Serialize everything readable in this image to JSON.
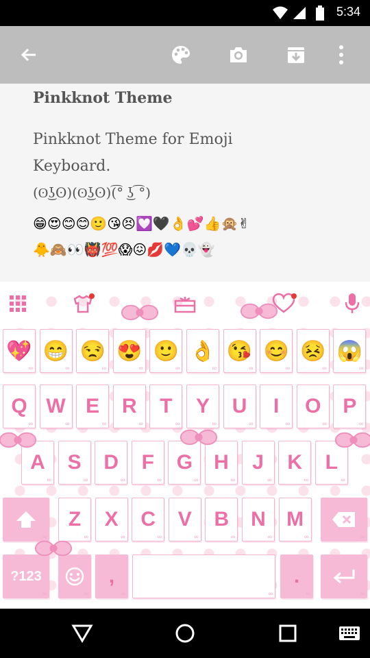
{
  "status_bar": {
    "time": "5:34",
    "icons": [
      "wifi-icon",
      "signal-icon",
      "battery-icon"
    ]
  },
  "app_bar": {
    "icons": [
      "back-arrow-icon",
      "palette-icon",
      "camera-icon",
      "archive-icon",
      "more-vert-icon"
    ]
  },
  "note": {
    "title": "Pinkknot Theme",
    "line1": "Pinkknot Theme for Emoji",
    "line2": "Keyboard.",
    "line3": "(ʘ͜ʖʘ)(ʘ͜ʖʘ)(͡° ͜ʖ ͡°)",
    "emoji_row1": "😁😍😊😊🙂😘😣💟🖤👌💕👍🙊✌",
    "emoji_row2": "🐥🙈👀👹💯😱😖💋💙💀👻"
  },
  "keyboard": {
    "toolbar_icons": [
      "apps-grid-icon",
      "theme-shirt-icon",
      "gift-icon",
      "heart-icon",
      "microphone-icon"
    ],
    "emoji_suggestions": [
      "💖",
      "😁",
      "😒",
      "😍",
      "🙂",
      "👌",
      "😘",
      "😊",
      "😣",
      "😱"
    ],
    "row1": [
      "Q",
      "W",
      "E",
      "R",
      "T",
      "Y",
      "U",
      "I",
      "O",
      "P"
    ],
    "row2": [
      "A",
      "S",
      "D",
      "F",
      "G",
      "H",
      "J",
      "K",
      "L"
    ],
    "row3": [
      "Z",
      "X",
      "C",
      "V",
      "B",
      "N",
      "M"
    ],
    "shift_icon": "shift-icon",
    "backspace_icon": "backspace-icon",
    "symbols_label": "?123",
    "comma_label": ",",
    "period_label": ".",
    "enter_icon": "enter-icon",
    "emoji_key_icon": "smiley-icon",
    "colors": {
      "accent": "#ec6fa6",
      "pink_key": "#f7bad6",
      "key_border": "#f3b4cd"
    }
  },
  "nav_bar": {
    "icons": [
      "back-triangle-icon",
      "home-circle-icon",
      "recents-square-icon",
      "keyboard-icon"
    ]
  }
}
